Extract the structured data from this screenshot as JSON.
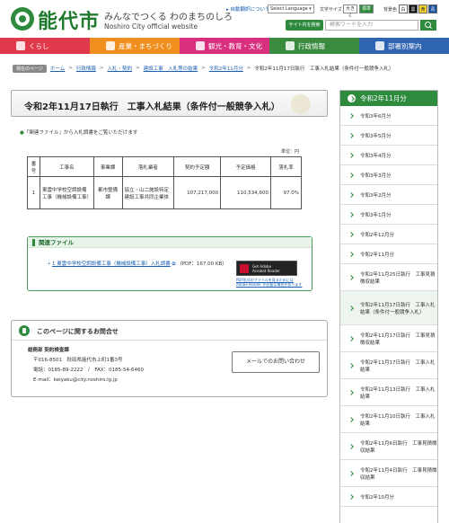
{
  "header": {
    "logo_text": "能代市",
    "tagline": "みんなでつくる わのまちのしろ",
    "site_en": "Noshiro City official website",
    "auto_translate_link": "自動翻訳について",
    "language_select": "Select Language",
    "text_size_label": "文字サイズ",
    "text_size_large": "大きく",
    "text_size_standard": "標準",
    "bg_color_label": "背景色",
    "bg_colors": [
      "白",
      "黒",
      "黄",
      "青"
    ],
    "search_label": "サイト内を検索",
    "search_placeholder": "検索ワードを入力"
  },
  "nav": [
    {
      "label": "くらし",
      "color": "#e0394b"
    },
    {
      "label": "産業・まちづくり",
      "color": "#f18f1e"
    },
    {
      "label": "観光・教育・文化",
      "color": "#d8307f"
    },
    {
      "label": "行政情報",
      "color": "#3a8b3f"
    },
    {
      "label": "部署別案内",
      "color": "#2f64b0"
    }
  ],
  "breadcrumb": {
    "current_tag": "現在のページ",
    "links": [
      "ホーム",
      "行政情報",
      "入札・契約",
      "建設工事　入札等の結果",
      "令和2年11月分"
    ],
    "current": "令和2年11月17日執行　工事入札結果（条件付一般競争入札）"
  },
  "main": {
    "title": "令和2年11月17日執行　工事入札結果（条件付一般競争入札）",
    "intro": "「関連ファイル」から入札調書をご覧いただけます",
    "unit": "単位：円",
    "table": {
      "headers": [
        "番号",
        "工事名",
        "事業課",
        "落札業者",
        "契約予定額",
        "予定価格",
        "落札率"
      ],
      "rows": [
        [
          "1",
          "東雲中学校空調設備工事（機械設備工事）",
          "都市整備課",
          "協立・山二施設特定建設工事共同企業体",
          "107,217,000",
          "110,534,600",
          "97.0%"
        ]
      ]
    },
    "related": {
      "title": "関連ファイル",
      "file_link": "1 東雲中学校空調設備工事（機械設備工事）入札調書",
      "file_meta": "（PDF：167.00 KB）",
      "acrobat_text_1": "Get Adobe",
      "acrobat_text_2": "Acrobat Reader",
      "acrobat_note": "PDF形式のファイルを見るためにはAdobe Reader が必要な場合があります"
    },
    "contact": {
      "title": "このページに関するお問合せ",
      "dept": "総務部 契約検査課",
      "address": "〒016-8501　秋田県能代市上町1番3号",
      "phone": "電話：0185-89-2222　/　FAX：0185-54-6460",
      "email": "E-mail：keiyaku@city.noshiro.lg.jp",
      "mail_button": "メールでのお問い合わせ"
    }
  },
  "sidebar": {
    "title": "令和2年11月分",
    "items": [
      {
        "label": "令和3年6月分",
        "height": 22
      },
      {
        "label": "令和3年5月分",
        "height": 22
      },
      {
        "label": "令和3年4月分",
        "height": 22
      },
      {
        "label": "令和3年3月分",
        "height": 22
      },
      {
        "label": "令和3年2月分",
        "height": 22
      },
      {
        "label": "令和3年1月分",
        "height": 22
      },
      {
        "label": "令和2年12月分",
        "height": 22
      },
      {
        "label": "令和2年11月分",
        "height": 22
      },
      {
        "label": "令和2年11月25日執行　工事見積徴収結果",
        "height": 30
      },
      {
        "label": "令和2年11月17日執行　工事入札結果（条件付一般競争入札）",
        "height": 38,
        "active": true
      },
      {
        "label": "令和2年11月17日執行　工事見積徴収結果",
        "height": 30
      },
      {
        "label": "令和2年11月17日執行　工事入札結果",
        "height": 30
      },
      {
        "label": "令和2年11月13日執行　工事入札結果",
        "height": 30
      },
      {
        "label": "令和2年11月10日執行　工事入札結果",
        "height": 30
      },
      {
        "label": "令和2年11月6日執行　工事見積徴収結果",
        "height": 30
      },
      {
        "label": "令和2年11月4日執行　工事見積徴収結果",
        "height": 30
      },
      {
        "label": "令和2年10月分",
        "height": 22
      }
    ]
  }
}
